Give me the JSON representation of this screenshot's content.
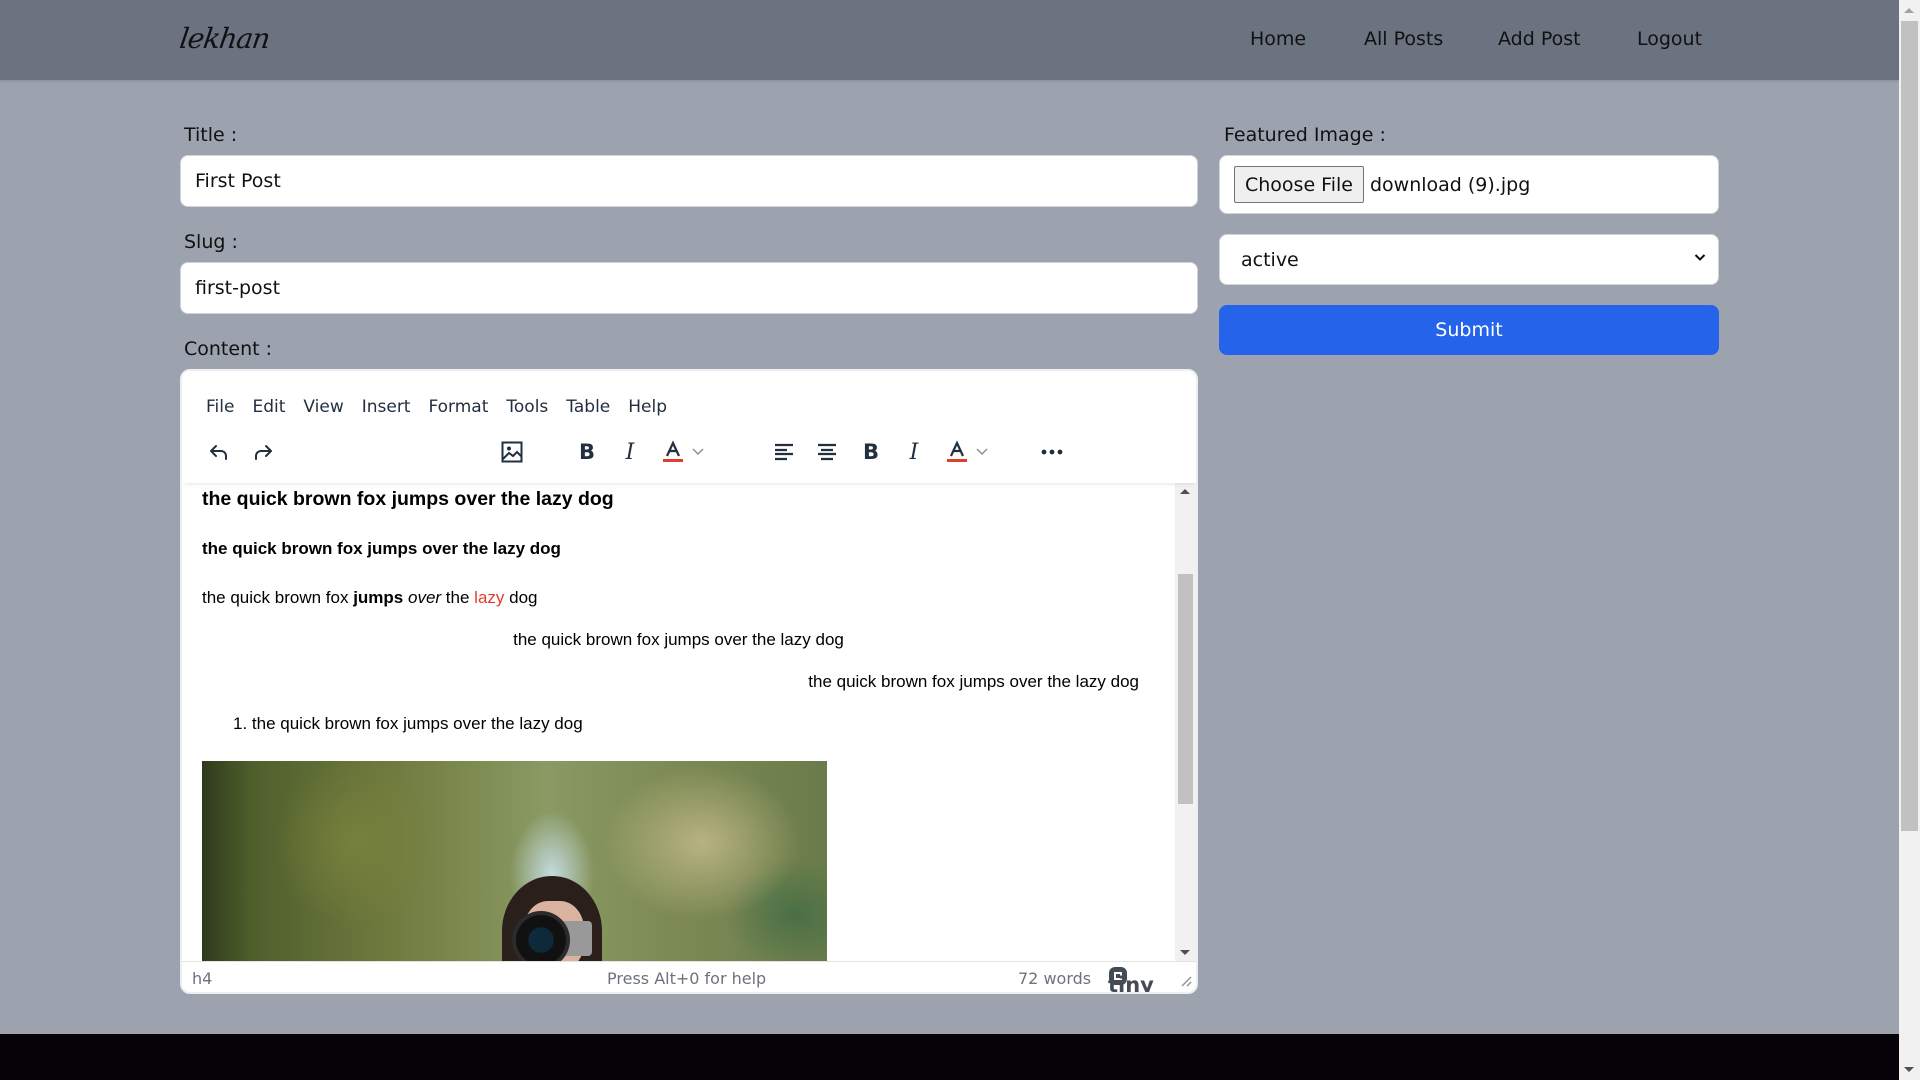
{
  "navbar": {
    "logo": "lekhan",
    "links": [
      "Home",
      "All Posts",
      "Add Post",
      "Logout"
    ]
  },
  "form": {
    "title_label": "Title :",
    "title_value": "First Post",
    "slug_label": "Slug :",
    "slug_value": "first-post",
    "content_label": "Content :",
    "featured_label": "Featured Image :",
    "choose_file_label": "Choose File",
    "file_name": "download (9).jpg",
    "status_selected": "active",
    "submit_label": "Submit"
  },
  "editor": {
    "menu": [
      "File",
      "Edit",
      "View",
      "Insert",
      "Format",
      "Tools",
      "Table",
      "Help"
    ],
    "block_format": "Heading 4",
    "toolbar_icons": [
      "undo-icon",
      "redo-icon",
      "image-icon",
      "bold-icon",
      "italic-icon",
      "text-color-icon",
      "align-left-icon",
      "align-center-icon",
      "bold-icon",
      "italic-icon",
      "text-color-icon",
      "more-icon"
    ],
    "text_color_accent": "#e03e2d",
    "content": {
      "h3": "the quick brown fox jumps over the lazy dog",
      "h4": "the quick brown fox jumps over the lazy dog",
      "mixed": {
        "part1": "the quick brown fox ",
        "bold": "jumps",
        "italic": "over",
        "part2": " the ",
        "red": "lazy",
        "part3": " dog"
      },
      "centered": "the quick brown fox jumps over the lazy dog",
      "right": "the quick brown fox jumps over the lazy dog",
      "list_number": "1.",
      "list_item": "the quick brown fox jumps over the lazy dog"
    },
    "status": {
      "path": "h4",
      "help": "Press Alt+0 for help",
      "word_count": "72 words",
      "brand": "tiny"
    }
  },
  "colors": {
    "navbar": "#6b7280",
    "page_bg": "#9ca3af",
    "submit": "#2563eb",
    "footer": "#050307"
  }
}
